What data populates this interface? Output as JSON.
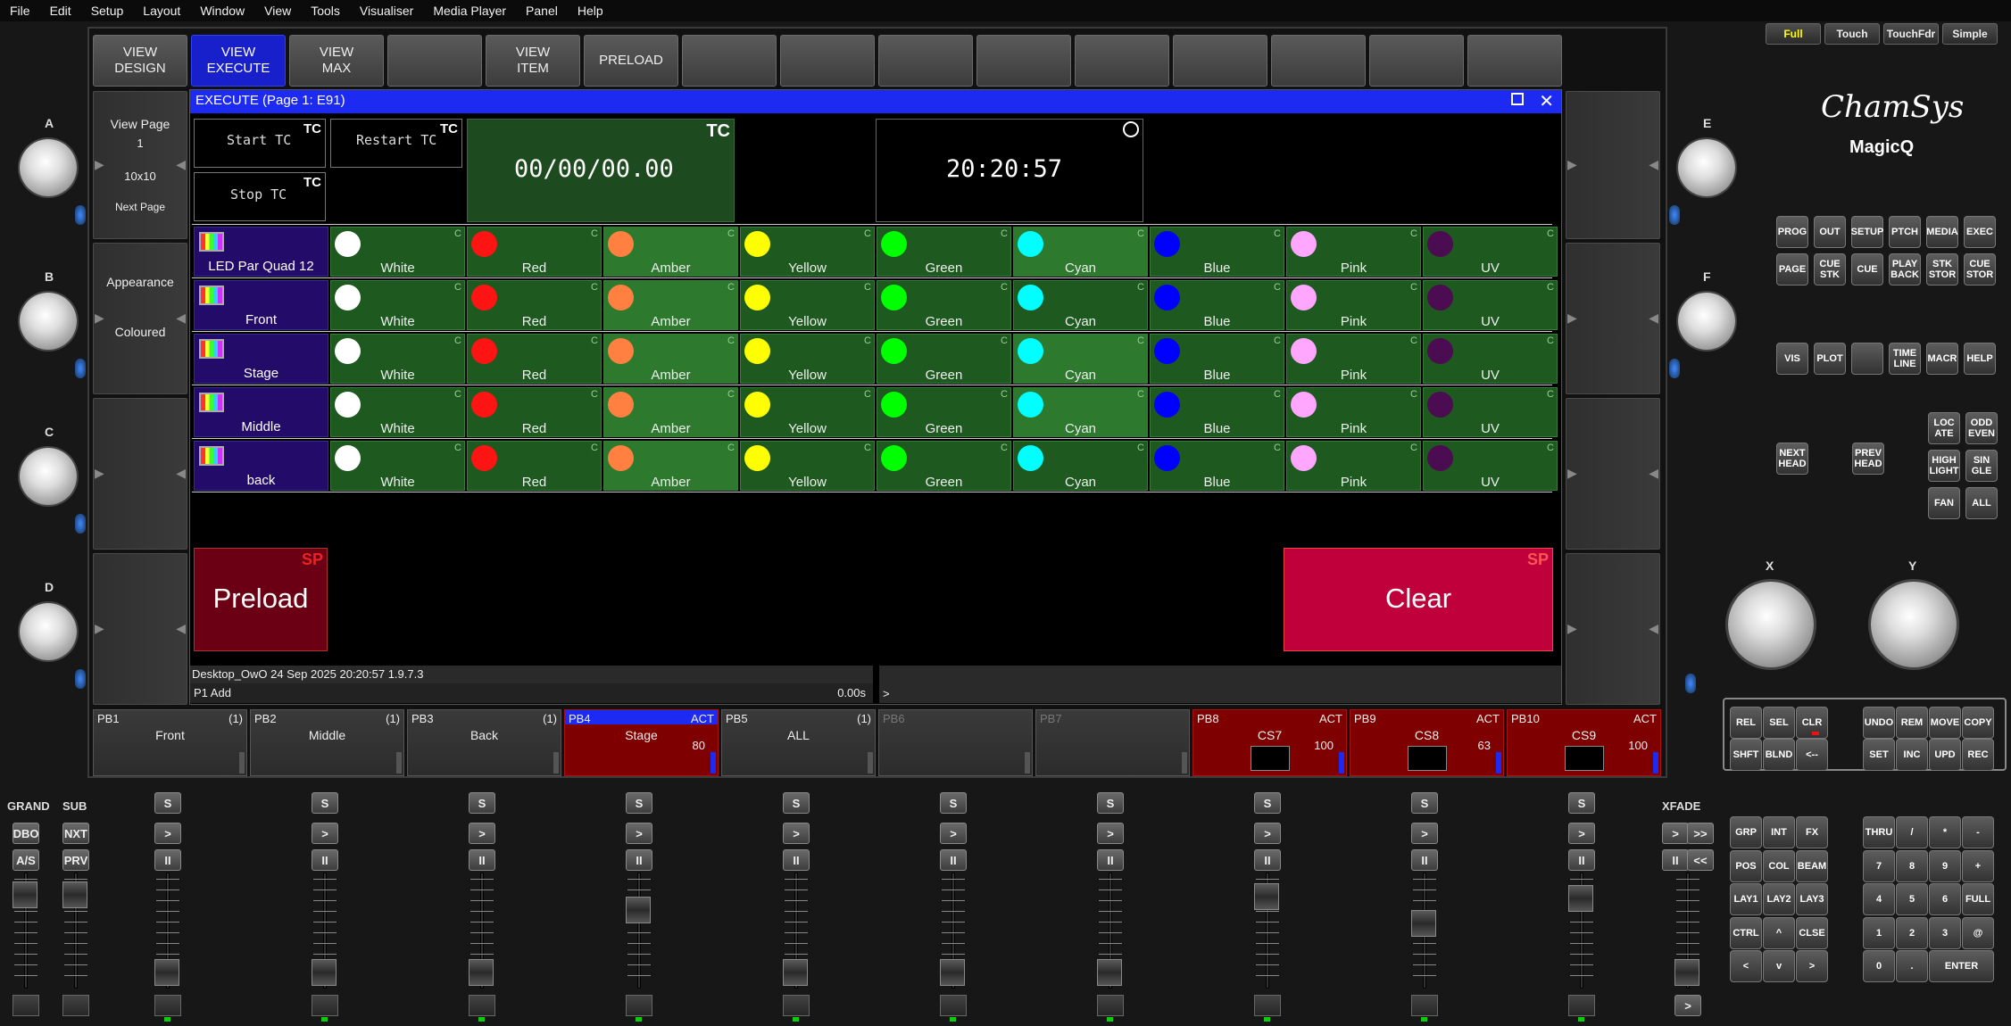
{
  "menu": [
    "File",
    "Edit",
    "Setup",
    "Layout",
    "Window",
    "View",
    "Tools",
    "Visualiser",
    "Media Player",
    "Panel",
    "Help"
  ],
  "view_tabs": [
    {
      "label": "VIEW\nDESIGN"
    },
    {
      "label": "VIEW\nEXECUTE"
    },
    {
      "label": "VIEW\nMAX"
    },
    {
      "label": ""
    },
    {
      "label": "VIEW\nITEM"
    },
    {
      "label": "PRELOAD"
    },
    {
      "label": ""
    },
    {
      "label": ""
    },
    {
      "label": ""
    },
    {
      "label": ""
    },
    {
      "label": ""
    },
    {
      "label": ""
    },
    {
      "label": ""
    },
    {
      "label": ""
    },
    {
      "label": ""
    }
  ],
  "left_side": {
    "view_page": "View Page",
    "page_num": "1",
    "grid": "10x10",
    "next_page": "Next Page",
    "appearance": "Appearance",
    "coloured": "Coloured"
  },
  "window": {
    "title": "EXECUTE (Page 1:  E91)",
    "start_tc": "Start TC",
    "restart_tc": "Restart TC",
    "stop_tc": "Stop TC",
    "tc_tag": "TC",
    "timecode": "00/00/00.00",
    "clock": "20:20:57",
    "preload": "Preload",
    "clear": "Clear",
    "sp_tag": "SP",
    "status": "Desktop_OwO 24 Sep 2025 20:20:57 1.9.7.3",
    "cmd_prefix": "P1  Add",
    "cmd_time": "0.00s",
    "cmd_prompt": ">"
  },
  "groups": [
    "LED Par Quad 12",
    "Front",
    "Stage",
    "Middle",
    "back"
  ],
  "colours": [
    {
      "label": "White",
      "hex": "#ffffff"
    },
    {
      "label": "Red",
      "hex": "#ff1414"
    },
    {
      "label": "Amber",
      "hex": "#ff8040"
    },
    {
      "label": "Yellow",
      "hex": "#ffff00"
    },
    {
      "label": "Green",
      "hex": "#00ff00"
    },
    {
      "label": "Cyan",
      "hex": "#00ffff"
    },
    {
      "label": "Blue",
      "hex": "#0000ff"
    },
    {
      "label": "Pink",
      "hex": "#ffa6ff"
    },
    {
      "label": "UV",
      "hex": "#4b0c52"
    }
  ],
  "cell_tag": "C",
  "active_cells": [
    [
      2,
      5
    ],
    [
      2
    ],
    [
      2,
      5
    ],
    [
      2,
      5
    ],
    [
      2
    ]
  ],
  "playbacks": [
    {
      "num": "PB1",
      "state": "(1)",
      "title": "Front",
      "level": "",
      "red": false,
      "hdr": false
    },
    {
      "num": "PB2",
      "state": "(1)",
      "title": "Middle",
      "level": "",
      "red": false,
      "hdr": false
    },
    {
      "num": "PB3",
      "state": "(1)",
      "title": "Back",
      "level": "",
      "red": false,
      "hdr": false
    },
    {
      "num": "PB4",
      "state": "ACT",
      "title": "Stage",
      "level": "80",
      "red": true,
      "hdr": true
    },
    {
      "num": "PB5",
      "state": "(1)",
      "title": "ALL",
      "level": "",
      "red": false,
      "hdr": false
    },
    {
      "num": "PB6",
      "state": "",
      "title": "",
      "level": "",
      "red": false,
      "hdr": false
    },
    {
      "num": "PB7",
      "state": "",
      "title": "",
      "level": "",
      "red": false,
      "hdr": false
    },
    {
      "num": "PB8",
      "state": "ACT",
      "title": "CS7",
      "level": "100",
      "red": true,
      "hdr": false
    },
    {
      "num": "PB9",
      "state": "ACT",
      "title": "CS8",
      "level": "63",
      "red": true,
      "hdr": false
    },
    {
      "num": "PB10",
      "state": "ACT",
      "title": "CS9",
      "level": "100",
      "red": true,
      "hdr": false
    }
  ],
  "labels": {
    "grand": "GRAND",
    "sub": "SUB",
    "xfade": "XFADE",
    "dbo": "DBO",
    "nxt": "NXT",
    "as": "A/S",
    "prv": "PRV",
    "s": "S",
    "go": ">",
    "pause": "II",
    "fwd": ">>",
    "back": "<<"
  },
  "encoders": {
    "a": "A",
    "b": "B",
    "c": "C",
    "d": "D",
    "e": "E",
    "f": "F",
    "x": "X",
    "y": "Y"
  },
  "modes": [
    "Full",
    "Touch",
    "TouchFdr",
    "Simple"
  ],
  "brand": {
    "name": "ChamSys",
    "product": "MagicQ"
  },
  "keys": {
    "r1": [
      "PROG",
      "OUT",
      "SETUP",
      "PTCH",
      "MEDIA",
      "EXEC"
    ],
    "r2": [
      "PAGE",
      "CUE\nSTK",
      "CUE",
      "PLAY\nBACK",
      "STK\nSTOR",
      "CUE\nSTOR"
    ],
    "r3": [
      "VIS",
      "PLOT",
      "",
      "TIME\nLINE",
      "MACR",
      "HELP"
    ],
    "head": [
      "LOC\nATE",
      "ODD\nEVEN",
      "HIGH\nLIGHT",
      "SIN\nGLE",
      "FAN",
      "ALL"
    ],
    "next_head": "NEXT\nHEAD",
    "prev_head": "PREV\nHEAD",
    "e1": [
      "REL",
      "SEL",
      "CLR"
    ],
    "e2": [
      "SHFT",
      "BLND",
      "<--"
    ],
    "u1": [
      "UNDO",
      "REM",
      "MOVE",
      "COPY"
    ],
    "u2": [
      "SET",
      "INC",
      "UPD",
      "REC"
    ],
    "p": [
      "GRP",
      "INT",
      "FX",
      "POS",
      "COL",
      "BEAM",
      "LAY1",
      "LAY2",
      "LAY3",
      "CTRL",
      "^",
      "CLSE",
      "<",
      "v",
      ">"
    ],
    "n": [
      "THRU",
      "/",
      "*",
      "-",
      "7",
      "8",
      "9",
      "+",
      "4",
      "5",
      "6",
      "FULL",
      "1",
      "2",
      "3",
      "@",
      "0",
      ".",
      "ENTER"
    ]
  }
}
